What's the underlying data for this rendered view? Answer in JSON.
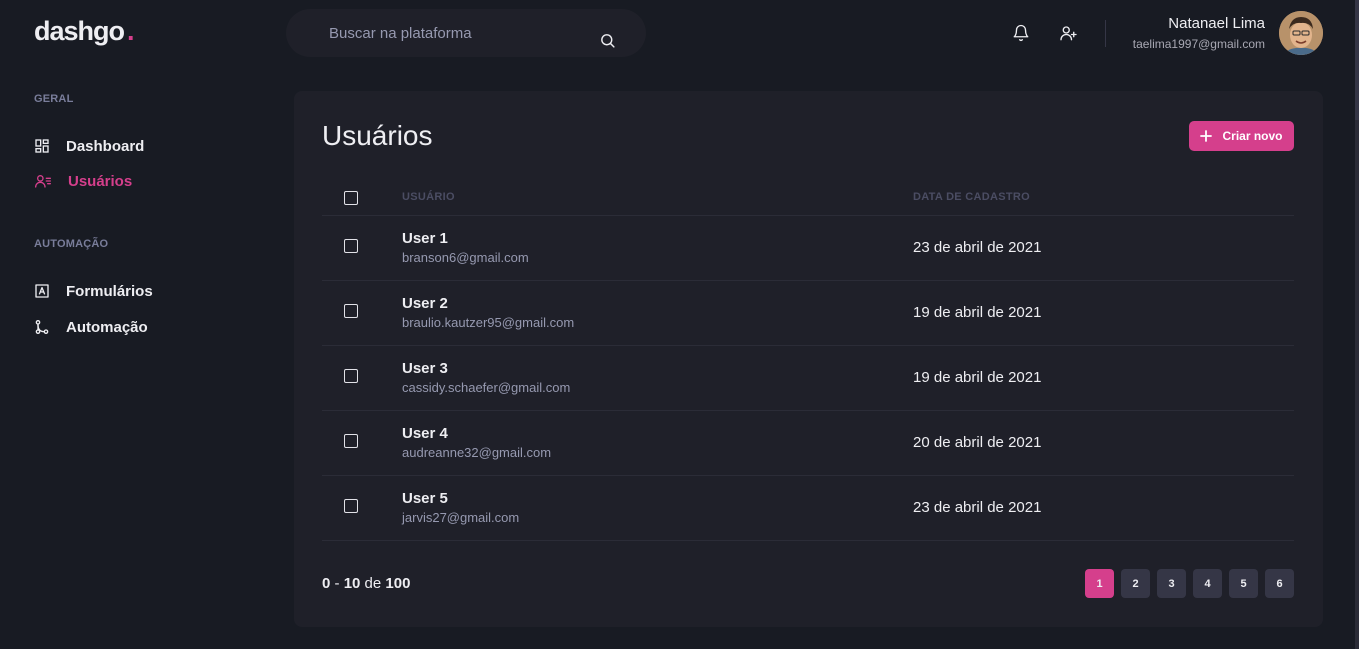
{
  "app": {
    "logo_text": "dashgo",
    "logo_dot": ".",
    "accent": "#d53f8c"
  },
  "search": {
    "placeholder": "Buscar na plataforma"
  },
  "header_icons": [
    "bell-icon",
    "user-add-icon"
  ],
  "profile": {
    "name": "Natanael Lima",
    "email": "taelima1997@gmail.com"
  },
  "sidebar": {
    "sections": [
      {
        "title": "GERAL",
        "items": [
          {
            "label": "Dashboard",
            "icon": "dashboard-icon",
            "active": false
          },
          {
            "label": "Usuários",
            "icon": "users-icon",
            "active": true
          }
        ]
      },
      {
        "title": "AUTOMAÇÃO",
        "items": [
          {
            "label": "Formulários",
            "icon": "form-icon",
            "active": false
          },
          {
            "label": "Automação",
            "icon": "git-merge-icon",
            "active": false
          }
        ]
      }
    ]
  },
  "main": {
    "title": "Usuários",
    "create_label": "Criar novo",
    "table": {
      "columns": [
        "USUÁRIO",
        "DATA DE CADASTRO"
      ],
      "rows": [
        {
          "name": "User 1",
          "email": "branson6@gmail.com",
          "date": "23 de abril de 2021"
        },
        {
          "name": "User 2",
          "email": "braulio.kautzer95@gmail.com",
          "date": "19 de abril de 2021"
        },
        {
          "name": "User 3",
          "email": "cassidy.schaefer@gmail.com",
          "date": "19 de abril de 2021"
        },
        {
          "name": "User 4",
          "email": "audreanne32@gmail.com",
          "date": "20 de abril de 2021"
        },
        {
          "name": "User 5",
          "email": "jarvis27@gmail.com",
          "date": "23 de abril de 2021"
        }
      ]
    },
    "pagination": {
      "range_start": "0",
      "range_sep": " - ",
      "range_end": "10",
      "of_label": " de ",
      "total": "100",
      "pages": [
        "1",
        "2",
        "3",
        "4",
        "5",
        "6"
      ],
      "current": "1"
    }
  }
}
